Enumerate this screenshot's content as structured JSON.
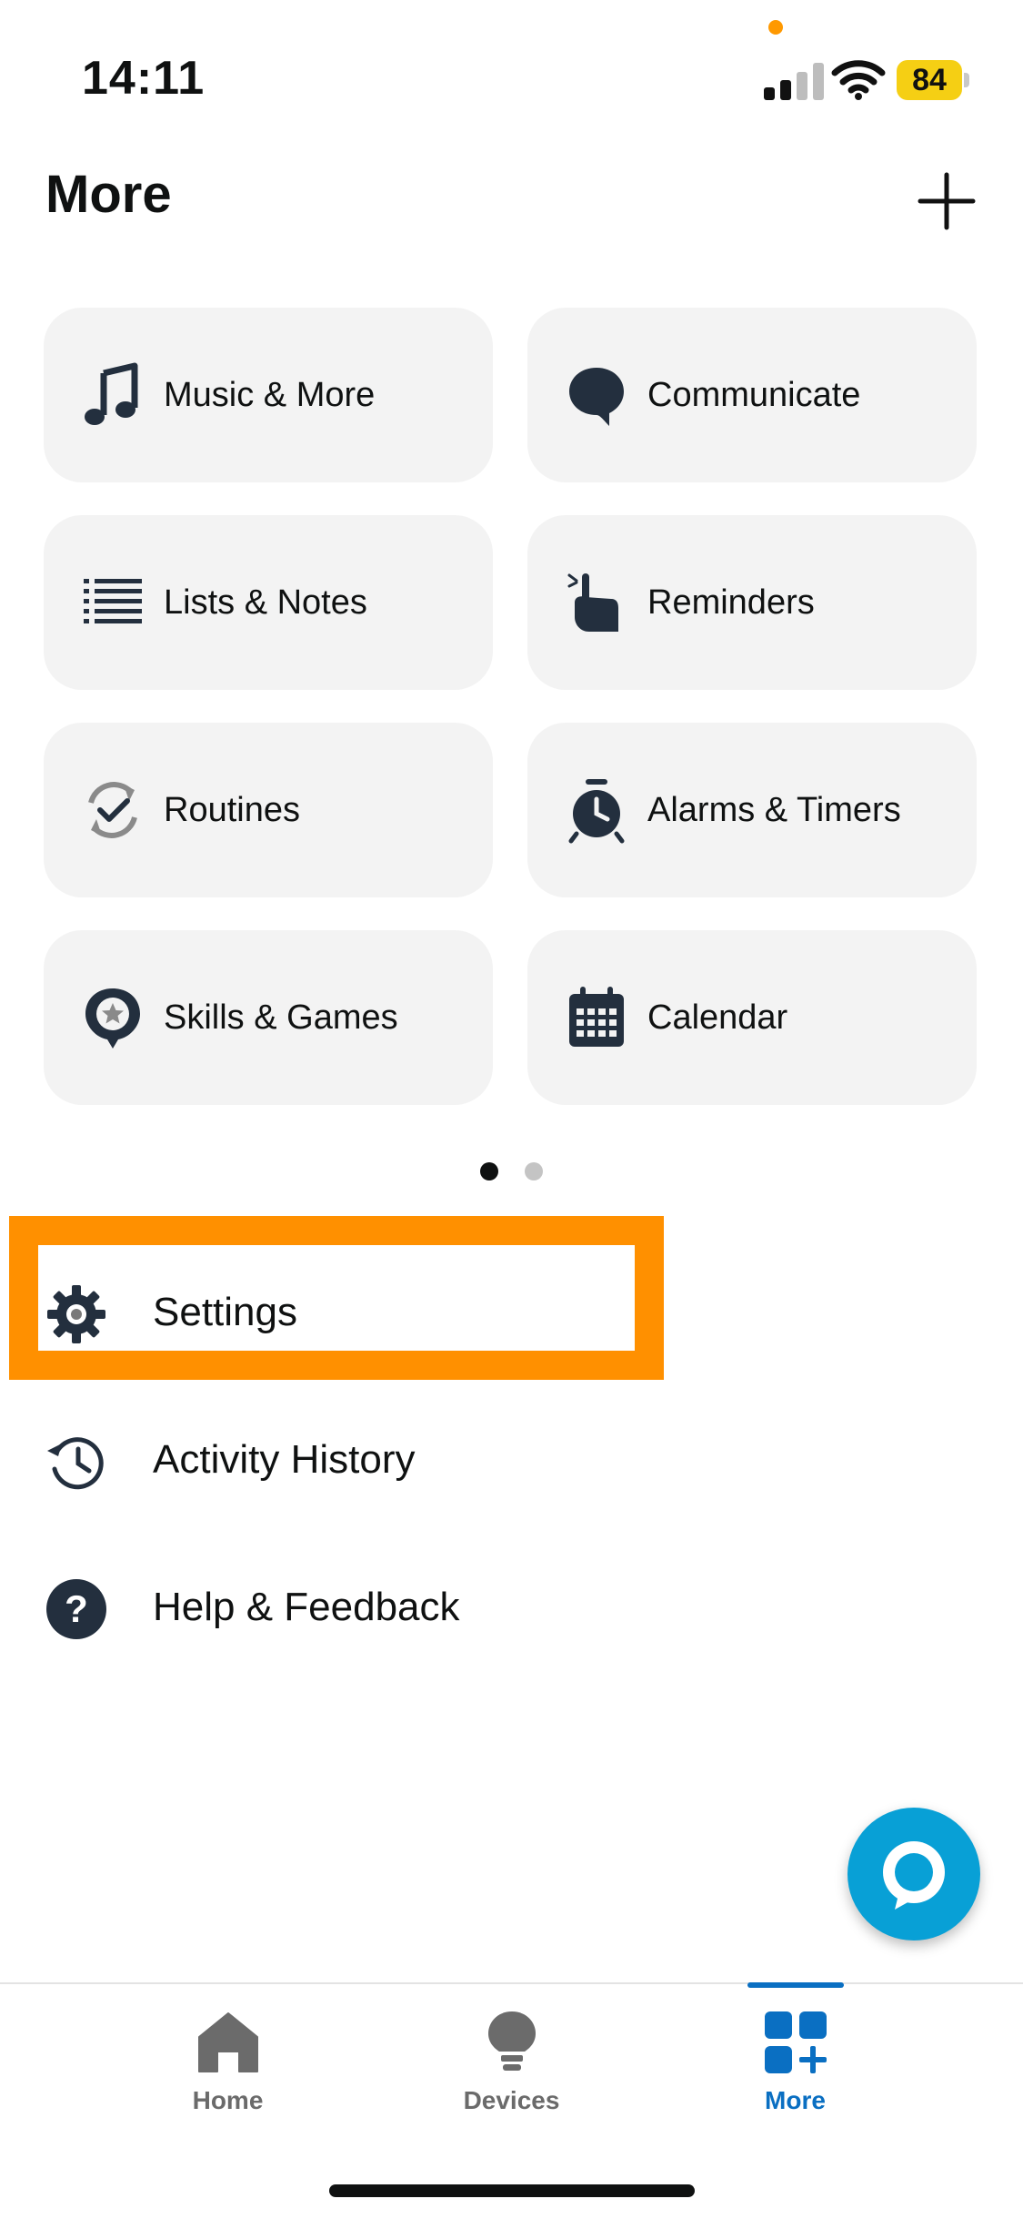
{
  "status_bar": {
    "time": "14:11",
    "battery": "84",
    "battery_color": "#f5cf14",
    "icons": [
      "signal-icon",
      "wifi-icon",
      "battery-icon"
    ]
  },
  "header": {
    "title": "More",
    "add_icon": "plus-icon"
  },
  "tiles": [
    {
      "label": "Music & More",
      "icon": "music-note-icon"
    },
    {
      "label": "Communicate",
      "icon": "speech-bubble-icon"
    },
    {
      "label": "Lists & Notes",
      "icon": "list-icon"
    },
    {
      "label": "Reminders",
      "icon": "reminder-hand-icon"
    },
    {
      "label": "Routines",
      "icon": "routines-check-icon"
    },
    {
      "label": "Alarms & Timers",
      "icon": "alarm-clock-icon"
    },
    {
      "label": "Skills & Games",
      "icon": "skills-star-icon"
    },
    {
      "label": "Calendar",
      "icon": "calendar-icon"
    }
  ],
  "pager": {
    "pages": 2,
    "current": 1
  },
  "list": [
    {
      "label": "Settings",
      "icon": "gear-icon",
      "highlighted": true
    },
    {
      "label": "Activity History",
      "icon": "history-clock-icon"
    },
    {
      "label": "Help & Feedback",
      "icon": "help-question-icon"
    }
  ],
  "highlight_color": "#ff9000",
  "alexa_button": {
    "icon": "alexa-ring-icon",
    "color": "#08a0d6"
  },
  "bottom_nav": {
    "items": [
      {
        "label": "Home",
        "icon": "home-icon"
      },
      {
        "label": "Devices",
        "icon": "lightbulb-icon"
      },
      {
        "label": "More",
        "icon": "more-grid-plus-icon",
        "active": true
      }
    ],
    "active_color": "#0a6fc2"
  }
}
